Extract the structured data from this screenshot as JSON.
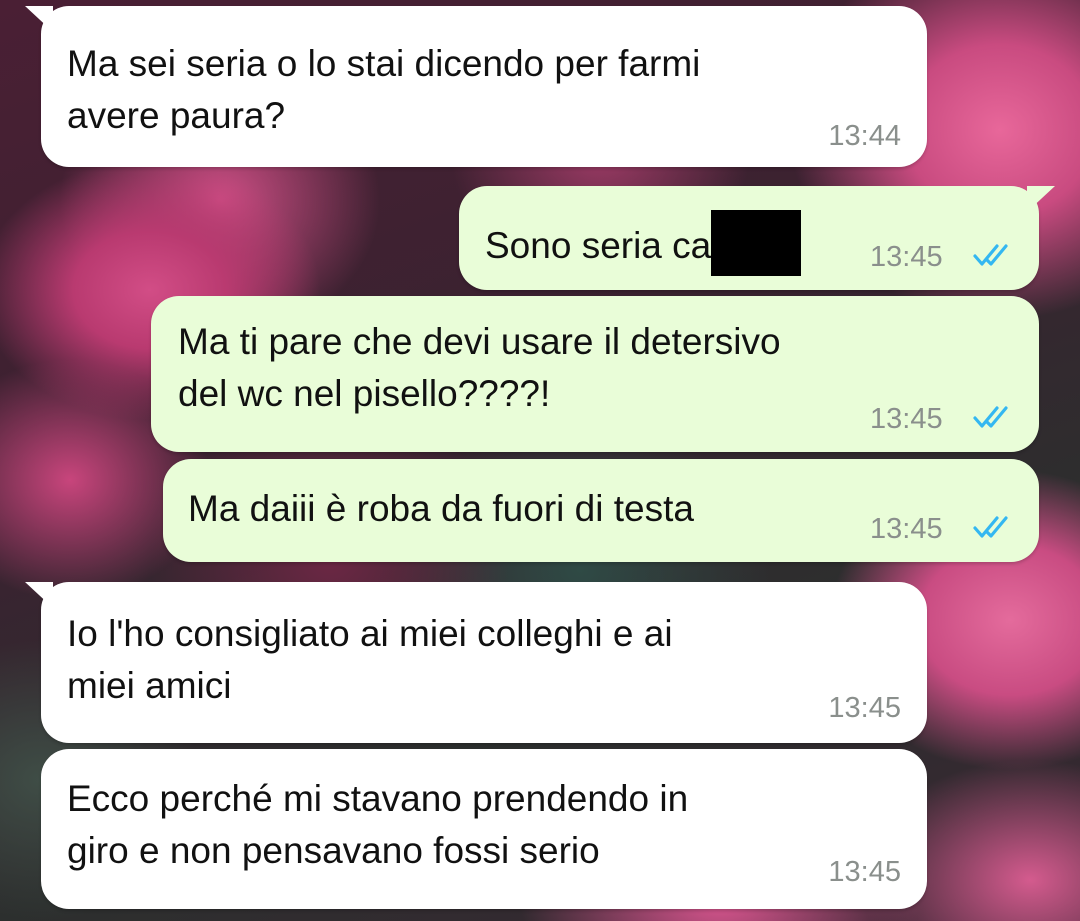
{
  "messages": [
    {
      "direction": "incoming",
      "text": "Ma sei seria o lo stai dicendo per farmi\navere paura?",
      "time": "13:44"
    },
    {
      "direction": "outgoing",
      "text": "Sono seria ca",
      "redacted": true,
      "time": "13:45",
      "status": "read"
    },
    {
      "direction": "outgoing",
      "text": "Ma ti pare che devi usare il detersivo\ndel wc nel pisello????!",
      "time": "13:45",
      "status": "read"
    },
    {
      "direction": "outgoing",
      "text": "Ma daiii è roba da fuori di testa",
      "time": "13:45",
      "status": "read"
    },
    {
      "direction": "incoming",
      "text": "Io l'ho consigliato ai miei colleghi e ai\nmiei amici",
      "time": "13:45"
    },
    {
      "direction": "incoming",
      "text": "Ecco perché mi stavano prendendo in\ngiro e non pensavano fossi serio",
      "time": "13:45"
    }
  ],
  "colors": {
    "incoming_bubble": "#ffffff",
    "outgoing_bubble": "#e9fdd8",
    "read_ticks": "#34b7f1",
    "timestamp": "#8a8f8c"
  },
  "icons": {
    "read_status": "double-check-icon"
  }
}
